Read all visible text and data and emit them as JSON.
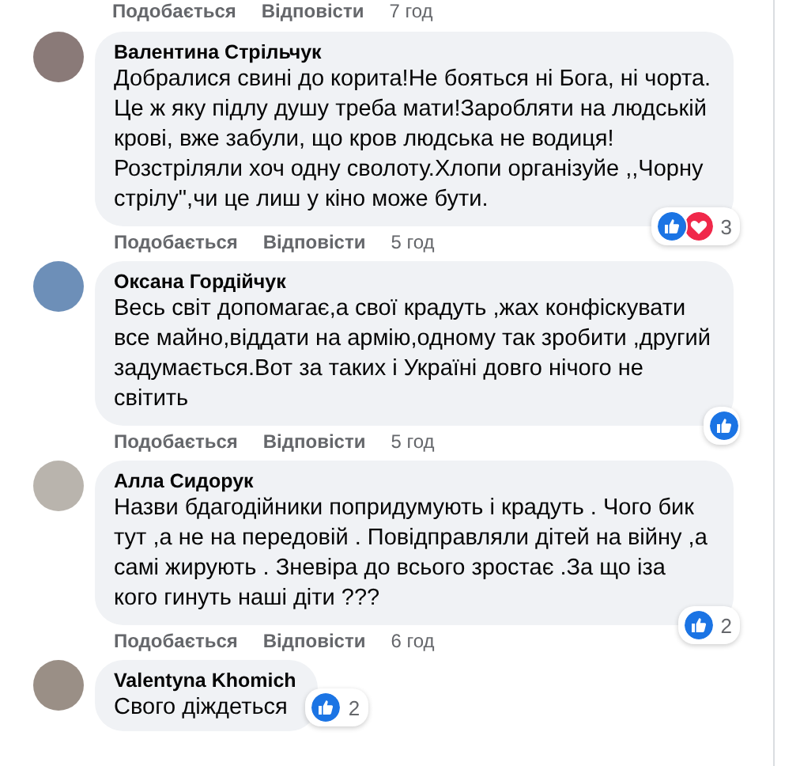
{
  "top_actions": {
    "like": "Подобається",
    "reply": "Відповісти",
    "time": "7 год"
  },
  "comments": [
    {
      "author": "Валентина Стрільчук",
      "text": "Добралися свині до корита!Не бояться ні Бога, ні чорта. Це ж яку підлу душу треба мати!Заробляти на людській крові, вже забули, що кров людська не водиця!Розстріляли хоч одну сволоту.Хлопи організуйе ,,Чорну стрілу\",чи це лиш у кіно може бути.",
      "reactions": [
        {
          "kind": "like"
        },
        {
          "kind": "love"
        }
      ],
      "reaction_count": "3",
      "kind": "long",
      "actions": {
        "like": "Подобається",
        "reply": "Відповісти",
        "time": "5 год"
      }
    },
    {
      "author": "Оксана Гордійчук",
      "text": "Весь світ допомагає,а свої крадуть ,жах конфіскувати все майно,віддати на армію,одному так зробити ,другий задумається.Вот за таких і Україні довго нічого не світить",
      "reactions": [
        {
          "kind": "like"
        }
      ],
      "kind": "long",
      "actions": {
        "like": "Подобається",
        "reply": "Відповісти",
        "time": "5 год"
      }
    },
    {
      "author": "Алла Сидорук",
      "text": "Назви бдагодійники попридумують і крадуть . Чого бик тут ,а не на передовій . Повідправляли дітей на війну ,а самі жирують . Зневіра до всього зростає .За що іза кого гинуть наші діти ???",
      "reactions": [
        {
          "kind": "like"
        }
      ],
      "reaction_count": "2",
      "kind": "long",
      "actions": {
        "like": "Подобається",
        "reply": "Відповісти",
        "time": "6 год"
      }
    },
    {
      "author": "Valentyna Khomich",
      "text": "Свого діждеться",
      "reactions": [
        {
          "kind": "like"
        }
      ],
      "reaction_count": "2",
      "kind": "short"
    }
  ]
}
